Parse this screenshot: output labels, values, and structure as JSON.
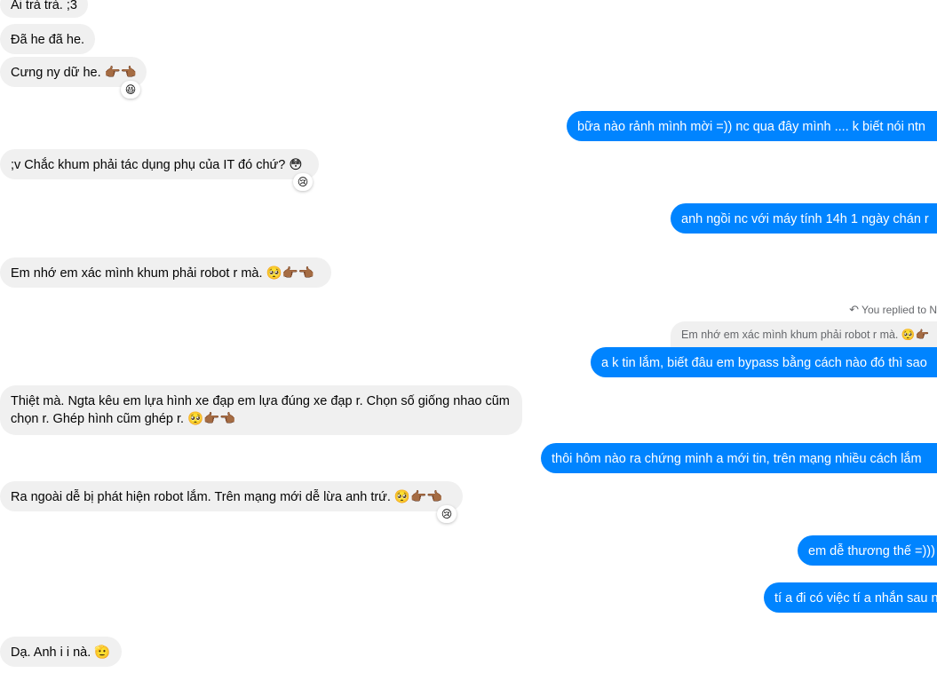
{
  "messages": {
    "m1": {
      "text": "Ai trà trà. ;3"
    },
    "m2": {
      "text": "Đã he đã he."
    },
    "m3": {
      "text": "Cưng ny dữ he. 👉🏾👈🏾",
      "reaction": "😆"
    },
    "m4": {
      "text": "bữa nào rảnh mình mời =)) nc qua đây mình .... k biết nói ntn"
    },
    "m5": {
      "text": ";v Chắc khum phải tác dụng phụ của IT đó chứ? 😳",
      "reaction": "😢"
    },
    "m6": {
      "text": "anh ngồi nc với máy tính 14h 1 ngày chán r"
    },
    "m7": {
      "text": "Em nhớ em xác mình khum phải robot r mà. 🥺👉🏾👈🏾"
    },
    "reply": {
      "meta": "You replied to N",
      "quote": "Em nhớ em xác mình khum phải robot r mà. 🥺👉🏾"
    },
    "m8": {
      "text": "a k tin lắm, biết đâu em bypass bằng cách nào đó thì sao"
    },
    "m9": {
      "text": "Thiệt mà. Ngta kêu em lựa hình xe đạp em lựa đúng xe đạp r. Chọn số giống nhao cũm chọn r. Ghép hình cũm ghép r. 🥺👉🏾👈🏾"
    },
    "m10": {
      "text": "thôi hôm nào ra chứng minh a mới tin, trên mạng nhiều cách lắm"
    },
    "m11": {
      "text": "Ra ngoài dễ bị phát hiện robot lắm. Trên mạng mới dễ lừa anh trứ. 🥺👉🏾👈🏾",
      "reaction": "😢"
    },
    "m12": {
      "text": "em dễ thương thế =)))"
    },
    "m13": {
      "text": "tí a đi có việc tí a nhắn sau n"
    },
    "m14": {
      "text": "Dạ. Anh i i nà. 🫡"
    }
  },
  "colors": {
    "incoming_bg": "#f0f0f0",
    "outgoing_bg": "#0084ff"
  },
  "icons": {
    "reply": "reply-arrow-icon"
  }
}
